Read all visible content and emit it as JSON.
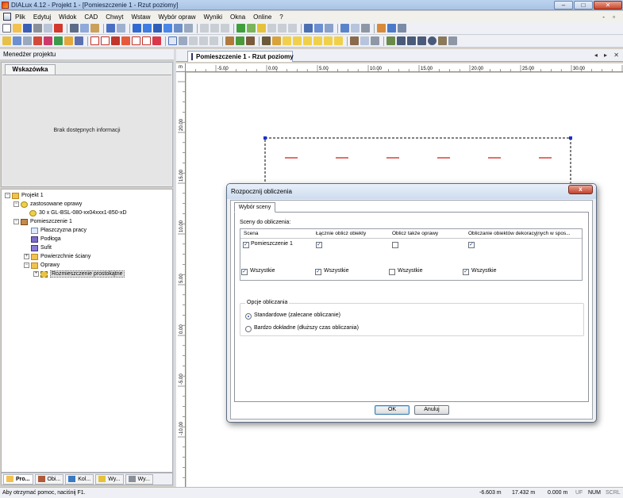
{
  "window": {
    "title": "DIALux 4.12 - Projekt 1 - [Pomieszczenie 1 - Rzut poziomy]",
    "minimize": "–",
    "maximize": "□",
    "close": "✕"
  },
  "menubar": {
    "items": [
      "Plik",
      "Edytuj",
      "Widok",
      "CAD",
      "Chwyt",
      "Wstaw",
      "Wybór opraw",
      "Wyniki",
      "Okna",
      "Online",
      "?"
    ],
    "mdi_controls": "- ▫"
  },
  "left_panel": {
    "header": "Menedżer projektu",
    "hint_tab": "Wskazówka",
    "hint_text": "Brak dostępnych informacji",
    "tree": [
      {
        "label": "Projekt 1",
        "icon": "folder-icon",
        "expander": "−"
      },
      {
        "label": "zastosowane oprawy",
        "icon": "lamp-icon",
        "expander": "−"
      },
      {
        "label": "30 x GL-BSL-080-xx04xxx1-850-xD",
        "icon": "luminaire-icon",
        "expander": ""
      },
      {
        "label": "Pomieszczenie 1",
        "icon": "room-icon",
        "expander": "−"
      },
      {
        "label": "Płaszczyzna pracy",
        "icon": "work-plane-icon",
        "expander": ""
      },
      {
        "label": "Podłoga",
        "icon": "floor-icon",
        "expander": ""
      },
      {
        "label": "Sufit",
        "icon": "ceiling-icon",
        "expander": ""
      },
      {
        "label": "Powierzchnie ściany",
        "icon": "folder-icon",
        "expander": "+"
      },
      {
        "label": "Oprawy",
        "icon": "folder-icon",
        "expander": "−"
      },
      {
        "label": "Rozmieszczenie prostokątne",
        "icon": "arrangement-icon",
        "expander": "+"
      }
    ],
    "bottom_tabs": [
      "Pro...",
      "Obi...",
      "Kol...",
      "Wy...",
      "Wy..."
    ]
  },
  "document": {
    "tab_label": "Pomieszczenie 1 - Rzut poziomy",
    "nav": "◂ ▸ ✕",
    "ruler_unit": "m",
    "ruler_x_labels": [
      "-5.00",
      "0.00",
      "5.00",
      "10.00",
      "15.00",
      "20.00",
      "25.00",
      "30.00"
    ],
    "ruler_y_labels": [
      "20.00",
      "15.00",
      "10.00",
      "5.00",
      "0.00",
      "-5.00",
      "-10.00"
    ]
  },
  "dialog": {
    "title": "Rozpocznij obliczenia",
    "close": "x",
    "tab": "Wybór sceny",
    "scenes_label": "Sceny do obliczenia:",
    "table_headers": [
      "Scena",
      "Łącznie oblicz obiekty",
      "Oblicz także oprawy",
      "Obliczanie obiektów dekoracyjnych w spos..."
    ],
    "row": {
      "scene": "Pomieszczenie 1",
      "scene_checked": true,
      "objects_checked": true,
      "luminaires_checked": false,
      "decor_checked": true
    },
    "all_label": "Wszystkie",
    "all_checks": [
      true,
      true,
      false,
      true
    ],
    "options_legend": "Opcje obliczania",
    "option_standard": "Standardowe (zalecane obliczanie)",
    "option_precise": "Bardzo dokładne (dłuższy czas obliczania)",
    "selected_option": "standard",
    "ok": "OK",
    "cancel": "Anuluj"
  },
  "statusbar": {
    "help": "Aby otrzymać pomoc, naciśnij F1.",
    "x": "-6.603 m",
    "y": "17.432 m",
    "z": "0.000 m",
    "uf": "UF",
    "num": "NUM",
    "scrl": "SCRL"
  },
  "colors": {
    "luminaire_marks": "#d8312a",
    "room_outline": "#000000",
    "corner_handles": "#1a2fd6"
  }
}
